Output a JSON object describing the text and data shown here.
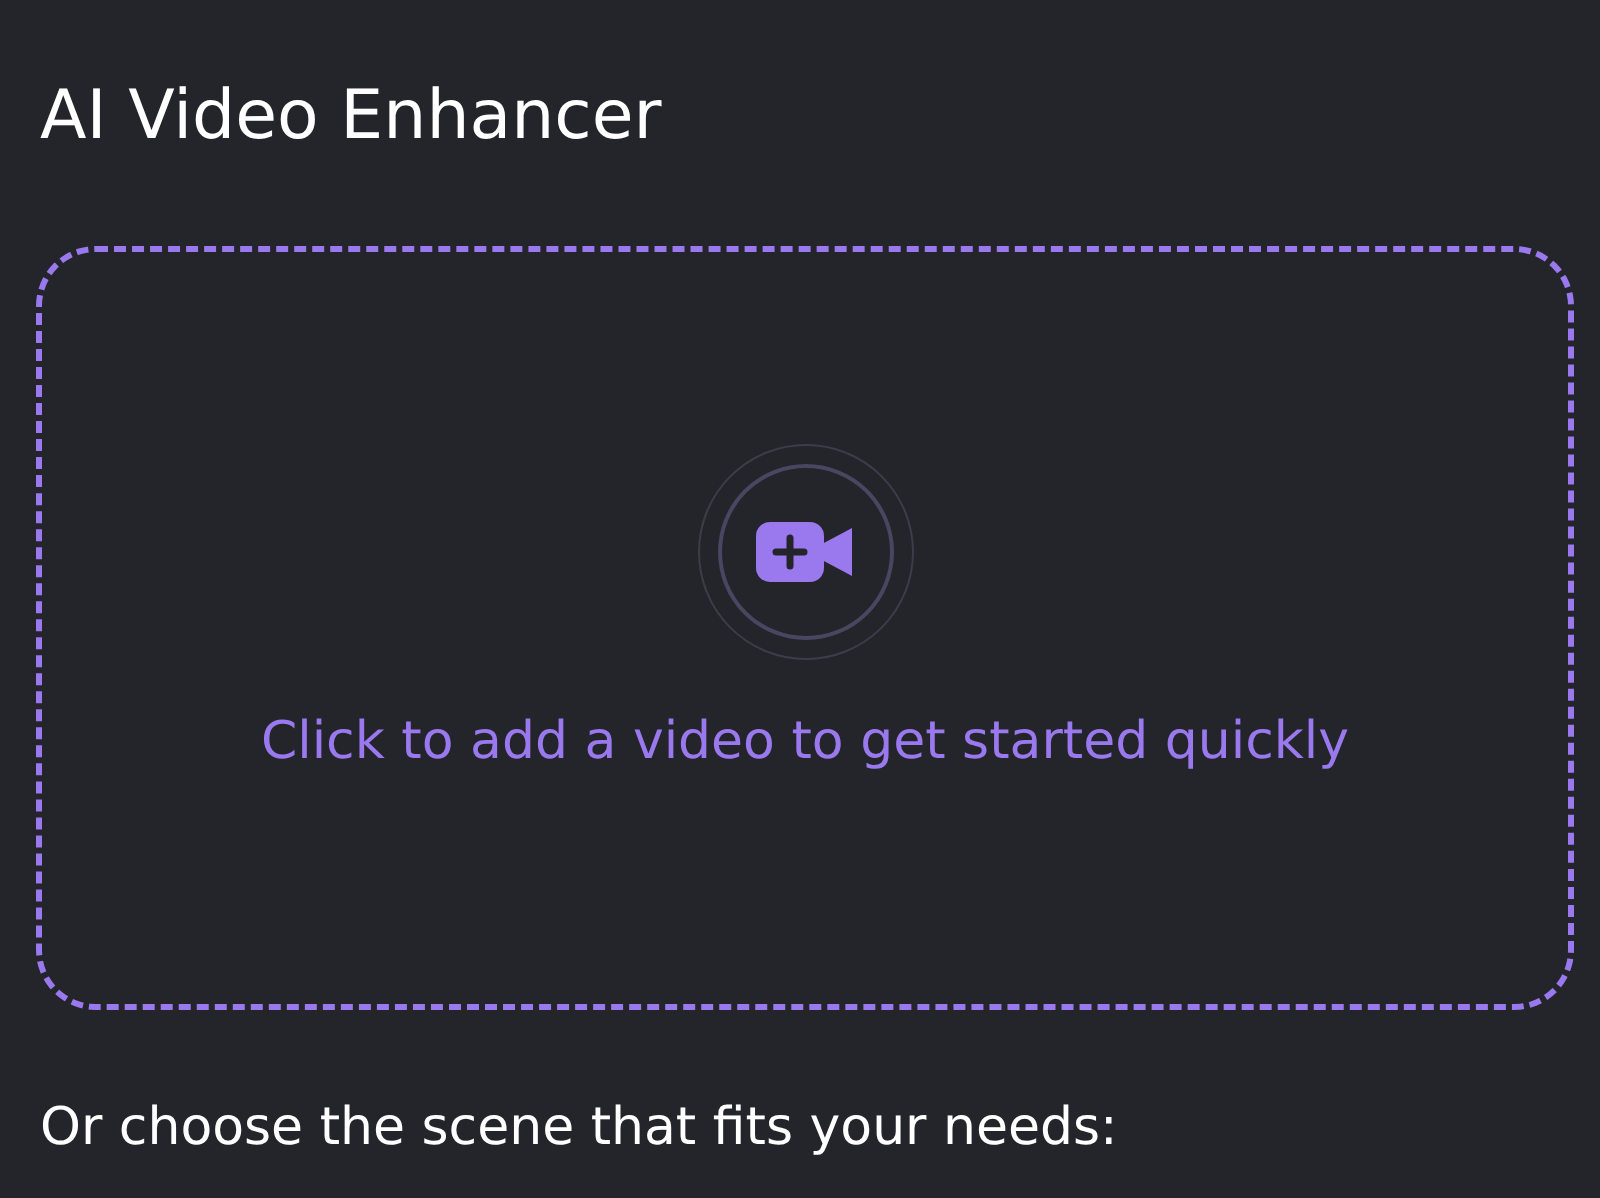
{
  "title": "AI Video Enhancer",
  "dropzone": {
    "prompt": "Click to add a video to get started quickly"
  },
  "scene_prompt": "Or choose the scene that fits your needs:"
}
